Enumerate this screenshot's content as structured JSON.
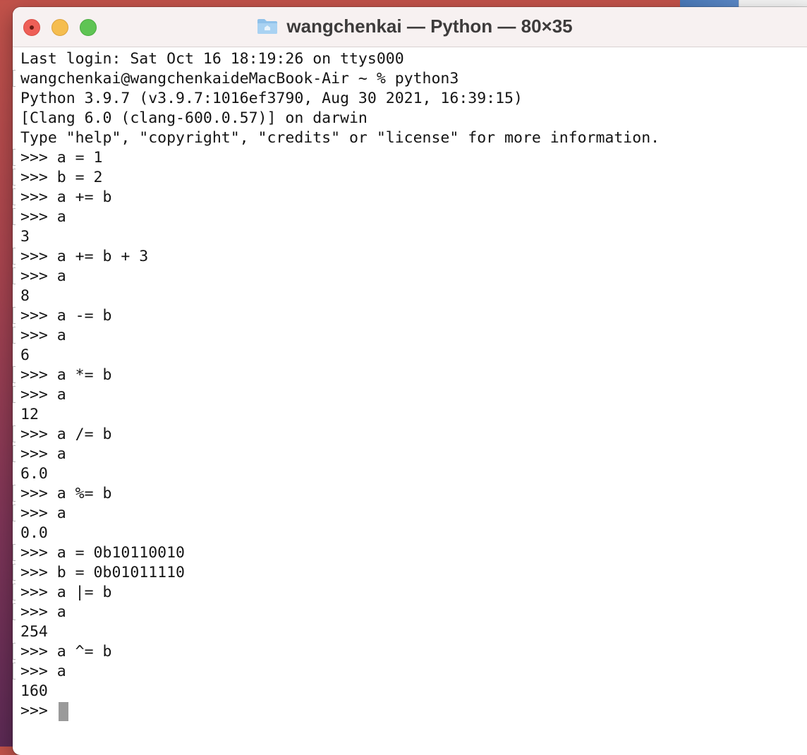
{
  "window": {
    "title": "wangchenkai — Python — 80×35",
    "icon": "folder-icon"
  },
  "terminal": {
    "lines": [
      {
        "text": "Last login: Sat Oct 16 18:19:26 on ttys000",
        "marked": false
      },
      {
        "text": "wangchenkai@wangchenkaideMacBook-Air ~ % python3",
        "marked": true
      },
      {
        "text": "Python 3.9.7 (v3.9.7:1016ef3790, Aug 30 2021, 16:39:15)",
        "marked": false
      },
      {
        "text": "[Clang 6.0 (clang-600.0.57)] on darwin",
        "marked": false
      },
      {
        "text": "Type \"help\", \"copyright\", \"credits\" or \"license\" for more information.",
        "marked": false
      },
      {
        "text": ">>> a = 1",
        "marked": true
      },
      {
        "text": ">>> b = 2",
        "marked": true
      },
      {
        "text": ">>> a += b",
        "marked": true
      },
      {
        "text": ">>> a",
        "marked": true
      },
      {
        "text": "3",
        "marked": false
      },
      {
        "text": ">>> a += b + 3",
        "marked": true
      },
      {
        "text": ">>> a",
        "marked": true
      },
      {
        "text": "8",
        "marked": false
      },
      {
        "text": ">>> a -= b",
        "marked": true
      },
      {
        "text": ">>> a",
        "marked": true
      },
      {
        "text": "6",
        "marked": false
      },
      {
        "text": ">>> a *= b",
        "marked": true
      },
      {
        "text": ">>> a",
        "marked": true
      },
      {
        "text": "12",
        "marked": false
      },
      {
        "text": ">>> a /= b",
        "marked": true
      },
      {
        "text": ">>> a",
        "marked": true
      },
      {
        "text": "6.0",
        "marked": false
      },
      {
        "text": ">>> a %= b",
        "marked": true
      },
      {
        "text": ">>> a",
        "marked": true
      },
      {
        "text": "0.0",
        "marked": false
      },
      {
        "text": ">>> a = 0b10110010",
        "marked": true
      },
      {
        "text": ">>> b = 0b01011110",
        "marked": true
      },
      {
        "text": ">>> a |= b",
        "marked": true
      },
      {
        "text": ">>> a",
        "marked": true
      },
      {
        "text": "254",
        "marked": false
      },
      {
        "text": ">>> a ^= b",
        "marked": true
      },
      {
        "text": ">>> a",
        "marked": true
      },
      {
        "text": "160",
        "marked": false
      }
    ],
    "prompt": ">>> "
  },
  "colors": {
    "text": "#141414",
    "cursor": "#9a9a9a",
    "titlebar": "#f7f1f1"
  }
}
